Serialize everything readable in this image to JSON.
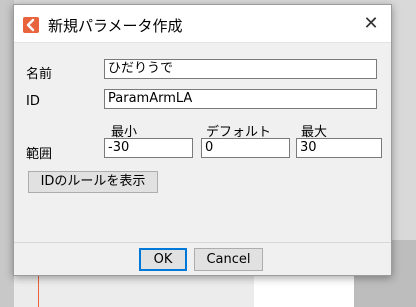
{
  "dialog": {
    "title": "新規パラメータ作成",
    "close_glyph": "✕"
  },
  "form": {
    "name_label": "名前",
    "name_value": "ひだりうで",
    "id_label": "ID",
    "id_value": "ParamArmLA",
    "range_label": "範囲",
    "min_label": "最小",
    "default_label": "デフォルト",
    "max_label": "最大",
    "min_value": "-30",
    "default_value": "0",
    "max_value": "30",
    "id_rules_button": "IDのルールを表示"
  },
  "footer": {
    "ok_label": "OK",
    "cancel_label": "Cancel"
  },
  "colors": {
    "accent": "#e8643c",
    "focus": "#0078d7"
  }
}
